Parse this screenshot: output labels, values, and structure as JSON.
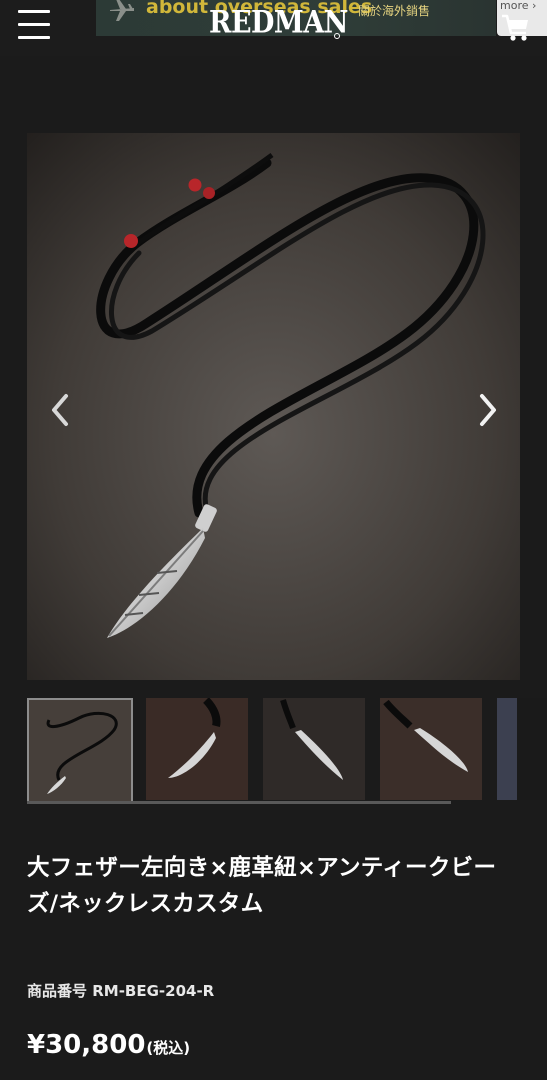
{
  "header": {
    "banner_en": "about overseas sales",
    "banner_zh": "關於海外銷售",
    "logo": "REDMAN",
    "more_label": "more ›"
  },
  "product": {
    "title": "大フェザー左向き×鹿革紐×アンティークビーズ/ネックレスカスタム",
    "sku": "商品番号 RM-BEG-204-R",
    "price": "¥30,800",
    "tax_note": "(税込)"
  },
  "icons": {
    "menu": "hamburger-menu-icon",
    "cart": "shopping-cart-icon",
    "plane": "airplane-icon",
    "prev": "chevron-left-icon",
    "next": "chevron-right-icon"
  },
  "colors": {
    "background": "#1b1b1b",
    "banner_text": "#d1b73a",
    "bead": "#c0282a"
  }
}
